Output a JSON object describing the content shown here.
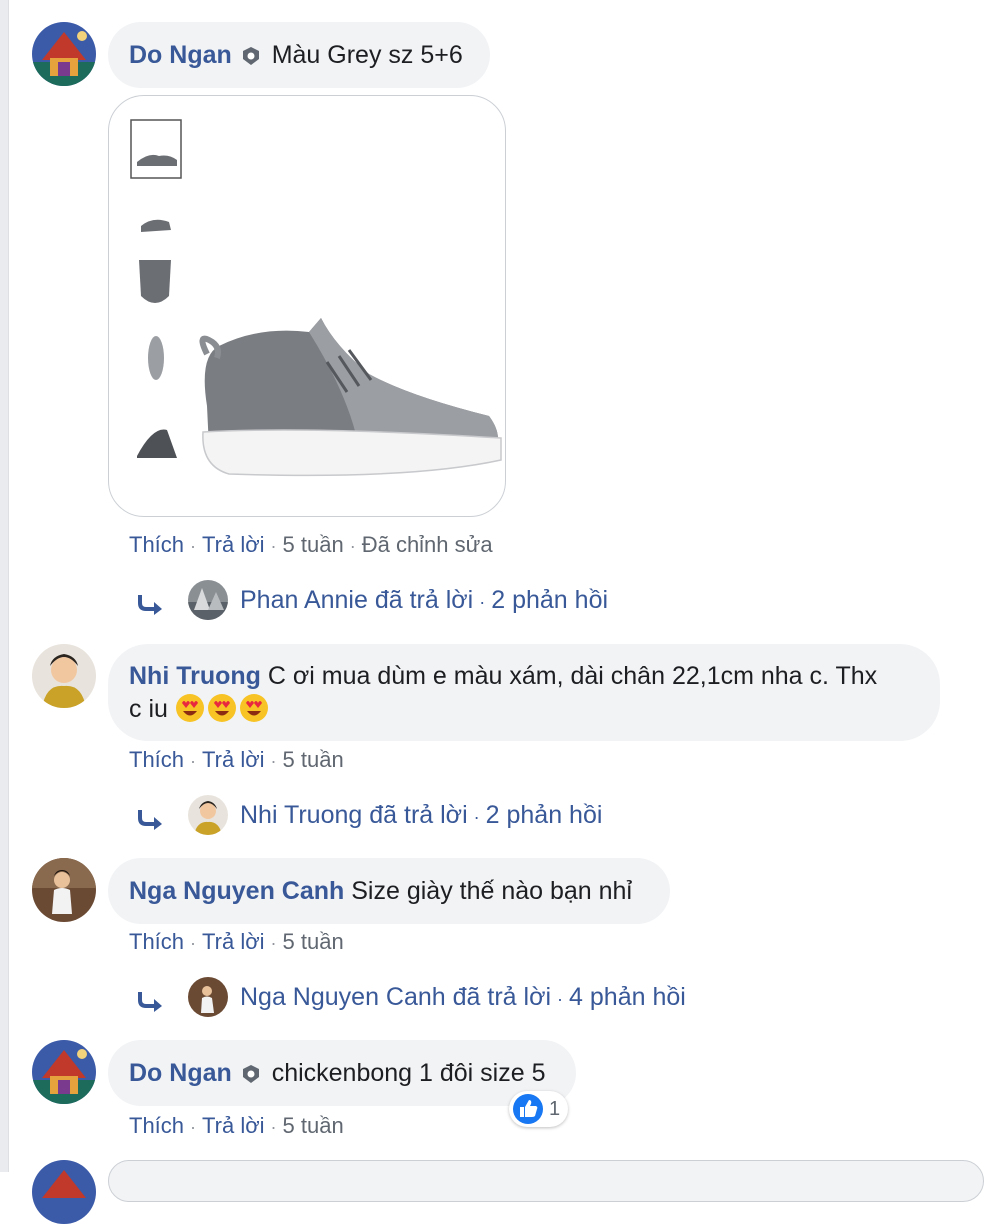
{
  "comments": [
    {
      "author": "Do Ngan",
      "text": "Màu Grey sz 5+6",
      "actions": {
        "like": "Thích",
        "reply": "Trả lời",
        "time": "5 tuần",
        "edited": "Đã chỉnh sửa"
      },
      "replies_summary": {
        "name": "Phan Annie",
        "suffix": "đã trả lời",
        "count": "2 phản hồi"
      }
    },
    {
      "author": "Nhi Truong",
      "text_line1": "C ơi mua dùm e màu xám, dài chân 22,1cm nha c. Thx",
      "text_line2": "c iu",
      "actions": {
        "like": "Thích",
        "reply": "Trả lời",
        "time": "5 tuần"
      },
      "replies_summary": {
        "name": "Nhi Truong",
        "suffix": "đã trả lời",
        "count": "2 phản hồi"
      }
    },
    {
      "author": "Nga Nguyen Canh",
      "text": "Size giày thế nào bạn nhỉ",
      "actions": {
        "like": "Thích",
        "reply": "Trả lời",
        "time": "5 tuần"
      },
      "replies_summary": {
        "name": "Nga Nguyen Canh",
        "suffix": "đã trả lời",
        "count": "4 phản hồi"
      }
    },
    {
      "author": "Do Ngan",
      "text": "chickenbong 1 đôi size 5",
      "actions": {
        "like": "Thích",
        "reply": "Trả lời",
        "time": "5 tuần"
      },
      "reaction_count": "1"
    }
  ],
  "colors": {
    "link": "#385898",
    "bubble": "#f2f3f5",
    "meta": "#606770",
    "like_blue": "#1877f2"
  },
  "icons": [
    "shield-badge-icon",
    "reply-arrow-icon",
    "heart-eyes-emoji",
    "like-thumb-icon"
  ]
}
